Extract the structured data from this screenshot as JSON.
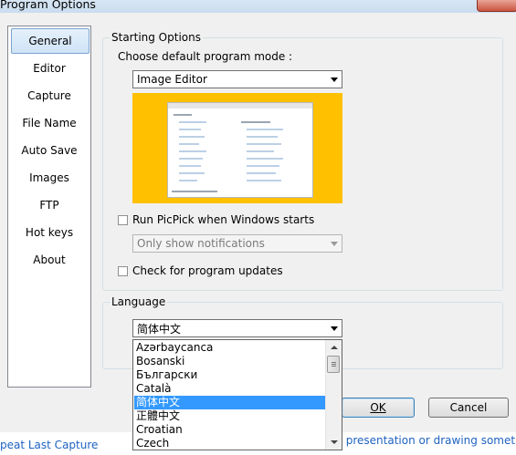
{
  "window": {
    "title": "Program Options"
  },
  "nav": {
    "items": [
      {
        "label": "General",
        "selected": true
      },
      {
        "label": "Editor"
      },
      {
        "label": "Capture"
      },
      {
        "label": "File Name"
      },
      {
        "label": "Auto Save"
      },
      {
        "label": "Images"
      },
      {
        "label": "FTP"
      },
      {
        "label": "Hot keys"
      },
      {
        "label": "About"
      }
    ]
  },
  "starting_options": {
    "group_label": "Starting Options",
    "mode_label": "Choose default program mode :",
    "mode_value": "Image Editor",
    "run_on_start_label": "Run PicPick when Windows starts",
    "run_on_start_checked": false,
    "notifications_value": "Only show notifications",
    "check_updates_label": "Check for program updates",
    "check_updates_checked": false
  },
  "language": {
    "group_label": "Language",
    "selected": "简体中文",
    "options": [
      "Azərbaycanca",
      "Bosanski",
      "Български",
      "Català",
      "简体中文",
      "正體中文",
      "Croatian",
      "Czech"
    ],
    "selected_index": 4
  },
  "buttons": {
    "ok": "OK",
    "cancel": "Cancel"
  },
  "status": {
    "left": "peat Last Capture",
    "right": "r presentation or drawing something"
  },
  "colors": {
    "preview_background": "#ffc000",
    "selection": "#3399ff",
    "link": "#1e62c2"
  }
}
